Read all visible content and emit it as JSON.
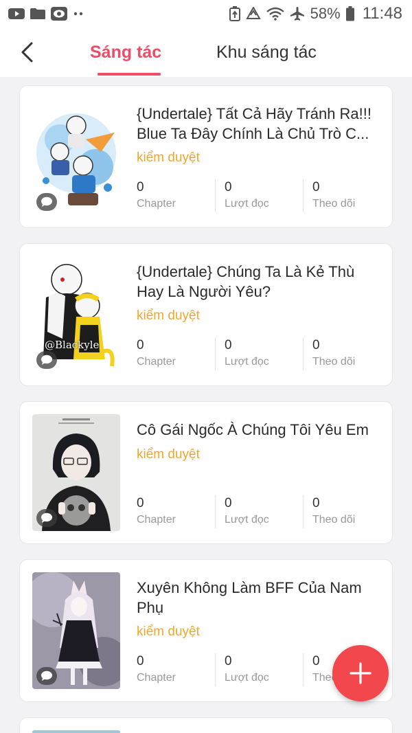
{
  "status_bar": {
    "battery_percent": "58%",
    "time": "11:48",
    "icons_left": [
      "youtube-icon",
      "folder-icon",
      "chat-app-icon",
      "more-dots-icon"
    ],
    "icons_right": [
      "battery-saver-icon",
      "data-saver-icon",
      "wifi-icon",
      "airplane-icon",
      "battery-icon"
    ]
  },
  "header": {
    "tabs": [
      {
        "label": "Sáng tác",
        "active": true
      },
      {
        "label": "Khu sáng tác",
        "active": false
      }
    ]
  },
  "stat_labels": {
    "chapter": "Chapter",
    "views": "Lượt đọc",
    "followers": "Theo dõi"
  },
  "stories": [
    {
      "title": "{Undertale} Tất Cả Hãy Tránh Ra!!! Blue Ta Đây Chính Là Chủ Trò C...",
      "status": "kiểm duyệt",
      "chapters": "0",
      "views": "0",
      "followers": "0",
      "cover_watermark": ""
    },
    {
      "title": "{Undertale} Chúng Ta Là Kẻ Thù Hay Là Người Yêu?",
      "status": "kiểm duyệt",
      "chapters": "0",
      "views": "0",
      "followers": "0",
      "cover_watermark": "@Blackyle"
    },
    {
      "title": "Cô Gái Ngốc À Chúng Tôi Yêu Em",
      "status": "kiểm duyệt",
      "chapters": "0",
      "views": "0",
      "followers": "0",
      "cover_watermark": ""
    },
    {
      "title": "Xuyên Không Làm BFF Của Nam Phụ",
      "status": "kiểm duyệt",
      "chapters": "0",
      "views": "0",
      "followers": "0",
      "cover_watermark": ""
    }
  ],
  "colors": {
    "accent": "#ef4c68",
    "status": "#f0a72a",
    "fab": "#f2474d"
  }
}
